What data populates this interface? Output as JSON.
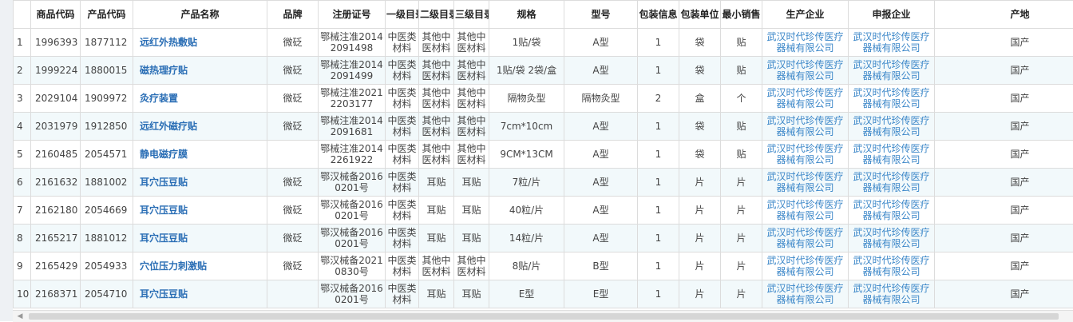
{
  "table": {
    "columns": [
      "",
      "商品代码",
      "产品代码",
      "产品名称",
      "品牌",
      "注册证号",
      "一级目录",
      "二级目录",
      "三级目录",
      "规格",
      "型号",
      "包装信息",
      "包装单位",
      "最小销售",
      "生产企业",
      "申报企业",
      "产地"
    ],
    "rows": [
      [
        "1",
        "1996393",
        "1877112",
        "远红外热敷贴",
        "微砭",
        "鄂械注准20142091498",
        "中医类材料",
        "其他中医材料",
        "其他中医材料",
        "1贴/袋",
        "A型",
        "1",
        "袋",
        "贴",
        "武汉时代珍传医疗器械有限公司",
        "武汉时代珍传医疗器械有限公司",
        "国产"
      ],
      [
        "2",
        "1999224",
        "1880015",
        "磁热理疗贴",
        "微砭",
        "鄂械注准20142091499",
        "中医类材料",
        "其他中医材料",
        "其他中医材料",
        "1贴/袋 2袋/盒",
        "A型",
        "1",
        "袋",
        "贴",
        "武汉时代珍传医疗器械有限公司",
        "武汉时代珍传医疗器械有限公司",
        "国产"
      ],
      [
        "3",
        "2029104",
        "1909972",
        "灸疗装置",
        "微砭",
        "鄂械注准20212203177",
        "中医类材料",
        "其他中医材料",
        "其他中医材料",
        "隔物灸型",
        "隔物灸型",
        "2",
        "盒",
        "个",
        "武汉时代珍传医疗器械有限公司",
        "武汉时代珍传医疗器械有限公司",
        "国产"
      ],
      [
        "4",
        "2031979",
        "1912850",
        "远红外磁疗贴",
        "微砭",
        "鄂械注准20142091681",
        "中医类材料",
        "其他中医材料",
        "其他中医材料",
        "7cm*10cm",
        "A型",
        "1",
        "袋",
        "贴",
        "武汉时代珍传医疗器械有限公司",
        "武汉时代珍传医疗器械有限公司",
        "国产"
      ],
      [
        "5",
        "2160485",
        "2054571",
        "静电磁疗膜",
        "",
        "鄂械注准20142261922",
        "中医类材料",
        "其他中医材料",
        "其他中医材料",
        "9CM*13CM",
        "A型",
        "1",
        "袋",
        "贴",
        "武汉时代珍传医疗器械有限公司",
        "武汉时代珍传医疗器械有限公司",
        "国产"
      ],
      [
        "6",
        "2161632",
        "1881002",
        "耳穴压豆贴",
        "微砭",
        "鄂汉械备20160201号",
        "中医类材料",
        "耳贴",
        "耳贴",
        "7粒/片",
        "A型",
        "1",
        "片",
        "片",
        "武汉时代珍传医疗器械有限公司",
        "武汉时代珍传医疗器械有限公司",
        "国产"
      ],
      [
        "7",
        "2162180",
        "2054669",
        "耳穴压豆贴",
        "微砭",
        "鄂汉械备20160201号",
        "中医类材料",
        "耳贴",
        "耳贴",
        "40粒/片",
        "A型",
        "1",
        "片",
        "片",
        "武汉时代珍传医疗器械有限公司",
        "武汉时代珍传医疗器械有限公司",
        "国产"
      ],
      [
        "8",
        "2165217",
        "1881012",
        "耳穴压豆贴",
        "微砭",
        "鄂汉械备20160201号",
        "中医类材料",
        "耳贴",
        "耳贴",
        "14粒/片",
        "A型",
        "1",
        "片",
        "片",
        "武汉时代珍传医疗器械有限公司",
        "武汉时代珍传医疗器械有限公司",
        "国产"
      ],
      [
        "9",
        "2165429",
        "2054933",
        "穴位压力刺激贴",
        "微砭",
        "鄂汉械备20210830号",
        "中医类材料",
        "其他中医材料",
        "其他中医材料",
        "8贴/片",
        "B型",
        "1",
        "片",
        "片",
        "武汉时代珍传医疗器械有限公司",
        "武汉时代珍传医疗器械有限公司",
        "国产"
      ],
      [
        "10",
        "2168371",
        "2054710",
        "耳穴压豆贴",
        "",
        "鄂汉械备20160201号",
        "中医类材料",
        "耳贴",
        "耳贴",
        "E型",
        "E型",
        "1",
        "片",
        "片",
        "武汉时代珍传医疗器械有限公司",
        "武汉时代珍传医疗器械有限公司",
        "国产"
      ]
    ]
  },
  "scrollbar": {
    "left_arrow": "◀"
  }
}
